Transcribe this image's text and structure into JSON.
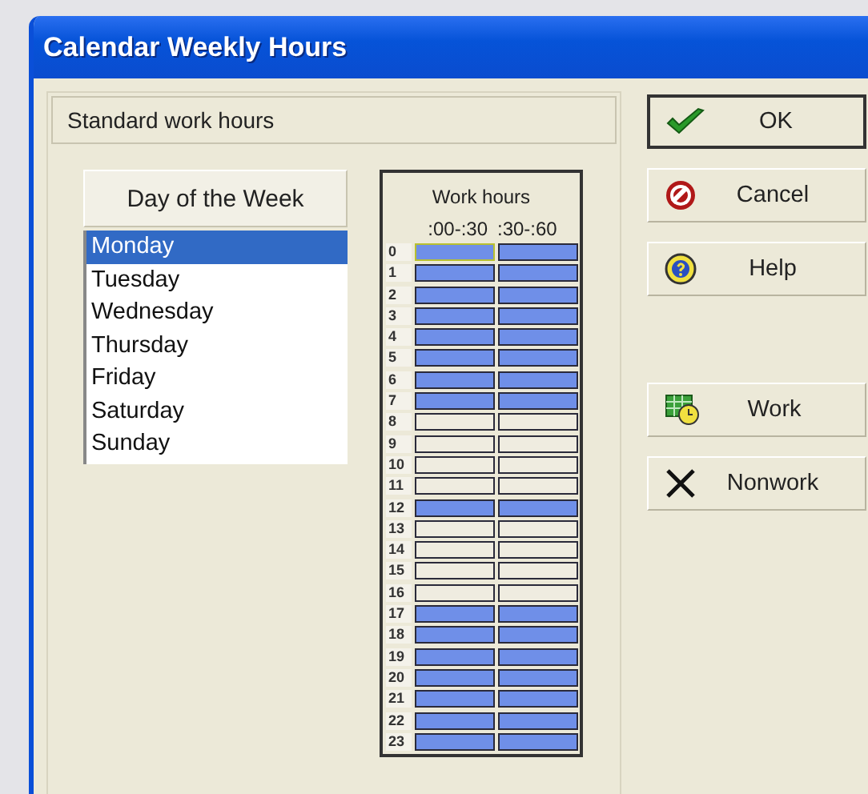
{
  "window": {
    "title": "Calendar Weekly Hours"
  },
  "section": {
    "title": "Standard work hours"
  },
  "days": {
    "header": "Day of the Week",
    "items": [
      {
        "label": "Monday",
        "selected": true
      },
      {
        "label": "Tuesday",
        "selected": false
      },
      {
        "label": "Wednesday",
        "selected": false
      },
      {
        "label": "Thursday",
        "selected": false
      },
      {
        "label": "Friday",
        "selected": false
      },
      {
        "label": "Saturday",
        "selected": false
      },
      {
        "label": "Sunday",
        "selected": false
      }
    ]
  },
  "work_hours": {
    "title": "Work hours",
    "columns": [
      ":00-:30",
      ":30-:60"
    ],
    "rows": [
      {
        "hour": "0",
        "work": [
          true,
          true
        ],
        "focused": [
          true,
          false
        ]
      },
      {
        "hour": "1",
        "work": [
          true,
          true
        ],
        "focused": [
          false,
          false
        ]
      },
      {
        "hour": "2",
        "work": [
          true,
          true
        ],
        "focused": [
          false,
          false
        ]
      },
      {
        "hour": "3",
        "work": [
          true,
          true
        ],
        "focused": [
          false,
          false
        ]
      },
      {
        "hour": "4",
        "work": [
          true,
          true
        ],
        "focused": [
          false,
          false
        ]
      },
      {
        "hour": "5",
        "work": [
          true,
          true
        ],
        "focused": [
          false,
          false
        ]
      },
      {
        "hour": "6",
        "work": [
          true,
          true
        ],
        "focused": [
          false,
          false
        ]
      },
      {
        "hour": "7",
        "work": [
          true,
          true
        ],
        "focused": [
          false,
          false
        ]
      },
      {
        "hour": "8",
        "work": [
          false,
          false
        ],
        "focused": [
          false,
          false
        ]
      },
      {
        "hour": "9",
        "work": [
          false,
          false
        ],
        "focused": [
          false,
          false
        ]
      },
      {
        "hour": "10",
        "work": [
          false,
          false
        ],
        "focused": [
          false,
          false
        ]
      },
      {
        "hour": "11",
        "work": [
          false,
          false
        ],
        "focused": [
          false,
          false
        ]
      },
      {
        "hour": "12",
        "work": [
          true,
          true
        ],
        "focused": [
          false,
          false
        ]
      },
      {
        "hour": "13",
        "work": [
          false,
          false
        ],
        "focused": [
          false,
          false
        ]
      },
      {
        "hour": "14",
        "work": [
          false,
          false
        ],
        "focused": [
          false,
          false
        ]
      },
      {
        "hour": "15",
        "work": [
          false,
          false
        ],
        "focused": [
          false,
          false
        ]
      },
      {
        "hour": "16",
        "work": [
          false,
          false
        ],
        "focused": [
          false,
          false
        ]
      },
      {
        "hour": "17",
        "work": [
          true,
          true
        ],
        "focused": [
          false,
          false
        ]
      },
      {
        "hour": "18",
        "work": [
          true,
          true
        ],
        "focused": [
          false,
          false
        ]
      },
      {
        "hour": "19",
        "work": [
          true,
          true
        ],
        "focused": [
          false,
          false
        ]
      },
      {
        "hour": "20",
        "work": [
          true,
          true
        ],
        "focused": [
          false,
          false
        ]
      },
      {
        "hour": "21",
        "work": [
          true,
          true
        ],
        "focused": [
          false,
          false
        ]
      },
      {
        "hour": "22",
        "work": [
          true,
          true
        ],
        "focused": [
          false,
          false
        ]
      },
      {
        "hour": "23",
        "work": [
          true,
          true
        ],
        "focused": [
          false,
          false
        ]
      }
    ]
  },
  "buttons": [
    {
      "label": "OK",
      "kind": "ok",
      "default": true
    },
    {
      "label": "Cancel",
      "kind": "cancel",
      "default": false
    },
    {
      "label": "Help",
      "kind": "help",
      "default": false
    },
    {
      "label": "Work",
      "kind": "work",
      "default": false
    },
    {
      "label": "Nonwork",
      "kind": "nonwork",
      "default": false
    }
  ]
}
